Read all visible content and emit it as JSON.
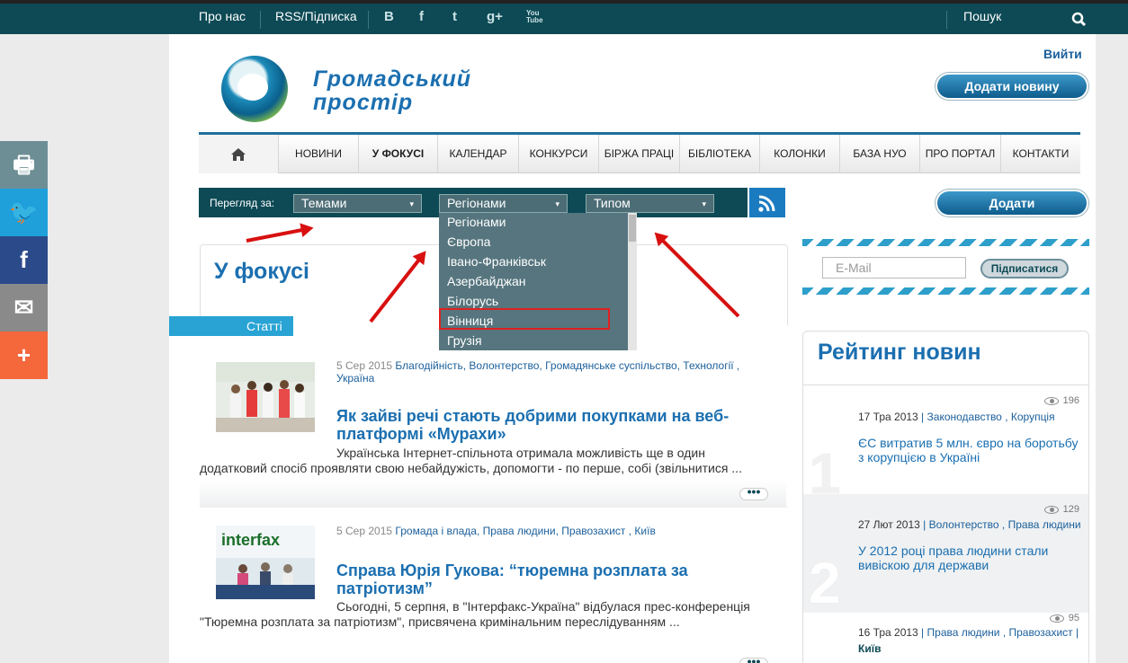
{
  "topbar": {
    "about": "Про нас",
    "rss": "RSS/Підписка",
    "social": [
      "B",
      "f",
      "t",
      "g+",
      "You Tube"
    ],
    "search": "Пошук"
  },
  "header": {
    "logo_line1": "Громадський",
    "logo_line2": "простір",
    "login": "Вийти",
    "add_news": "Додати новину"
  },
  "nav": [
    "НОВИНИ",
    "У ФОКУСІ",
    "КАЛЕНДАР",
    "КОНКУРСИ",
    "БІРЖА ПРАЦІ",
    "БІБЛІОТЕКА",
    "КОЛОНКИ",
    "БАЗА НУО",
    "ПРО ПОРТАЛ",
    "КОНТАКТИ"
  ],
  "filter": {
    "label": "Перегляд за:",
    "themes": "Темами",
    "regions": "Регіонами",
    "type": "Типом",
    "dropdown_options": [
      "Регіонами",
      "Європа",
      "Івано-Франківськ",
      "Азербайджан",
      "Білорусь",
      "Вінниця",
      "Грузія"
    ]
  },
  "add_button": "Додати",
  "main": {
    "title": "У фокусі",
    "tab": "Статті",
    "articles": [
      {
        "date": "5 Сер 2015",
        "tags": "Благодійність, Волонтерство, Громадянське суспільство, Технології , Україна",
        "title": "Як зайві речі стають добрими покупками на веб-платформі «Мурахи»",
        "text": "Українська Інтернет-спільнота отримала можливість ще в один додатковий спосіб проявляти свою небайдужість, допомогти - по перше, собі (звільнитися ..."
      },
      {
        "date": "5 Сер 2015",
        "tags": "Громада і влада, Права людини, Правозахист , Київ",
        "title": "Справа Юрія Гукова: “тюремна розплата за патріотизм”",
        "text": "Сьогодні, 5 серпня, в \"Інтерфакс-Україна\" відбулася прес-конференція \"Тюремна розплата за патріотизм\", присвячена кримінальним переслідуванням ...",
        "image_text": "interfax"
      }
    ],
    "more": "•••"
  },
  "subscribe": {
    "placeholder": "E-Mail",
    "button": "Підписатися"
  },
  "rating": {
    "title": "Рейтинг новин",
    "items": [
      {
        "num": "1",
        "views": "196",
        "date": "17 Тра 2013",
        "tags": "Законодавство , Корупція",
        "title": "ЄС витратив 5 млн. євро на боротьбу з корупцією в Україні"
      },
      {
        "num": "2",
        "views": "129",
        "date": "27 Лют 2013",
        "tags": "Волонтерство , Права людини",
        "title": "У 2012 році права людини стали вивіскою для держави"
      },
      {
        "num": "",
        "views": "95",
        "date": "16 Тра 2013",
        "tags": "Права людини , Правозахист |",
        "tags2": "Київ",
        "title": ""
      }
    ]
  },
  "share": [
    "🖶",
    "🐦",
    "f",
    "✉",
    "+"
  ],
  "colors": {
    "topbar": "#0d4a55",
    "accent": "#1b6fb0",
    "tab": "#28a3d4",
    "highlight": "#e02020"
  }
}
